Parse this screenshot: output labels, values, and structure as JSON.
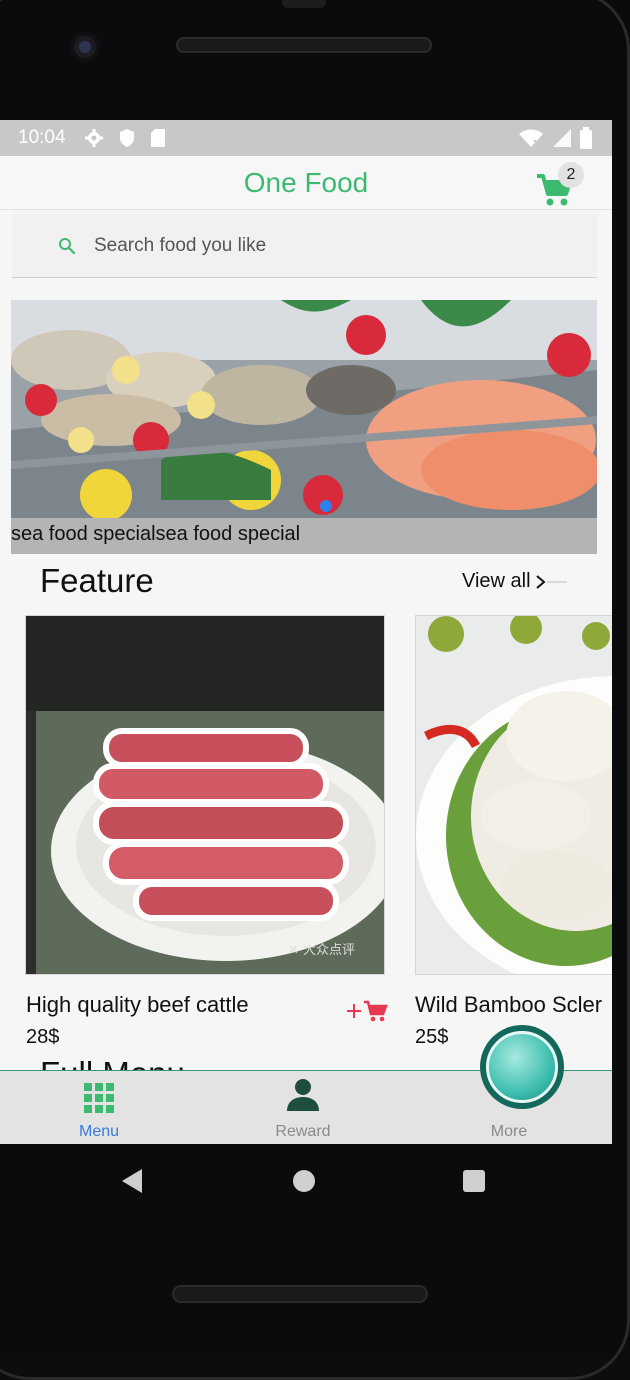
{
  "statusbar": {
    "time": "10:04",
    "icons": [
      "gear-icon",
      "shield-icon",
      "sdcard-icon",
      "wifi-off-icon",
      "signal-icon",
      "battery-icon"
    ]
  },
  "appbar": {
    "title": "One Food",
    "cart_count": "2"
  },
  "search": {
    "placeholder": "Search food you like"
  },
  "banner": {
    "caption": "sea food specialsea food special",
    "active_index": 0
  },
  "feature": {
    "heading": "Feature",
    "view_all": "View all",
    "items": [
      {
        "name": "High quality beef cattle",
        "price": "28$"
      },
      {
        "name": "Wild Bamboo Scler",
        "price": "25$"
      }
    ]
  },
  "full_menu": {
    "heading": "Full Menu"
  },
  "bottom_nav": {
    "items": [
      {
        "label": "Menu",
        "icon": "grid-icon",
        "active": true
      },
      {
        "label": "Reward",
        "icon": "person-icon",
        "active": false
      },
      {
        "label": "More",
        "icon": "more-icon",
        "active": false
      }
    ]
  },
  "colors": {
    "brand": "#3cba70",
    "active_nav": "#3a7bd5",
    "add_to_cart": "#e53950",
    "banner_dot": "#2f80ed"
  }
}
